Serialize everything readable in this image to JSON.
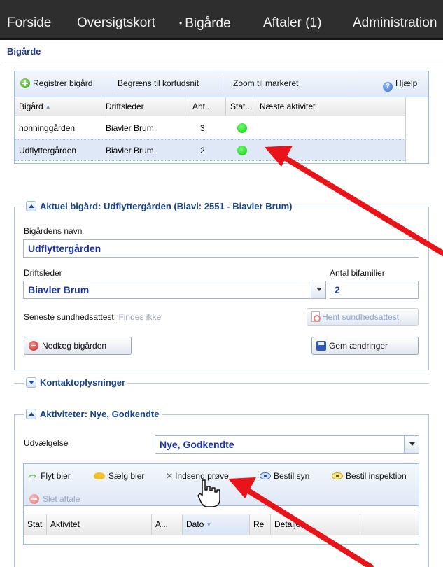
{
  "nav": {
    "items": [
      {
        "label": "Forside"
      },
      {
        "label": "Oversigtskort"
      },
      {
        "label": "Bigårde",
        "caret": "•"
      },
      {
        "label": "Aftaler (1)"
      },
      {
        "label": "Administration"
      }
    ]
  },
  "page": {
    "title": "Bigårde"
  },
  "apiary_grid": {
    "toolbar": {
      "register": "Registrér bigård",
      "limit": "Begræns til kortudsnit",
      "zoom": "Zoom til markeret",
      "help": "Hjælp"
    },
    "columns": [
      "Bigård",
      "Driftsleder",
      "Ant...",
      "Stat...",
      "Næste aktivitet"
    ],
    "rows": [
      {
        "name": "honninggården",
        "manager": "Biavler Brum",
        "count": "3",
        "status_color": "#1ed61e"
      },
      {
        "name": "Udflyttergården",
        "manager": "Biavler Brum",
        "count": "2",
        "status_color": "#1ed61e",
        "selected": true
      }
    ]
  },
  "current_apiary": {
    "legend": "Aktuel bigård: Udflyttergården (Biavl: 2551 - Biavler Brum)",
    "name_label": "Bigårdens navn",
    "name_value": "Udflyttergården",
    "manager_label": "Driftsleder",
    "manager_value": "Biavler Brum",
    "colonies_label": "Antal bifamilier",
    "colonies_value": "2",
    "health_label": "Seneste sundhedsattest:",
    "health_value": "Findes ikke",
    "fetch_cert": "Hent sundhedsattest",
    "close_button": "Nedlæg bigården",
    "save_button": "Gem ændringer"
  },
  "contact": {
    "legend": "Kontaktoplysninger"
  },
  "activities": {
    "legend": "Aktiviteter: Nye, Godkendte",
    "selection_label": "Udvælgelse",
    "selection_value": "Nye, Godkendte",
    "toolbar": {
      "move": "Flyt bier",
      "sell": "Sælg bier",
      "submit_sample": "Indsend prøve",
      "order_inspection_view": "Bestil syn",
      "order_inspection": "Bestil inspektion",
      "delete": "Slet aftale"
    },
    "columns": [
      "Stat",
      "Aktivitet",
      "A...",
      "Dato",
      "Re",
      "Detaljer"
    ]
  },
  "colors": {
    "nav_bg": "#2e2e2e",
    "accent": "#15428b",
    "field_text": "#1b33a8",
    "annotation": "#e8141a"
  }
}
